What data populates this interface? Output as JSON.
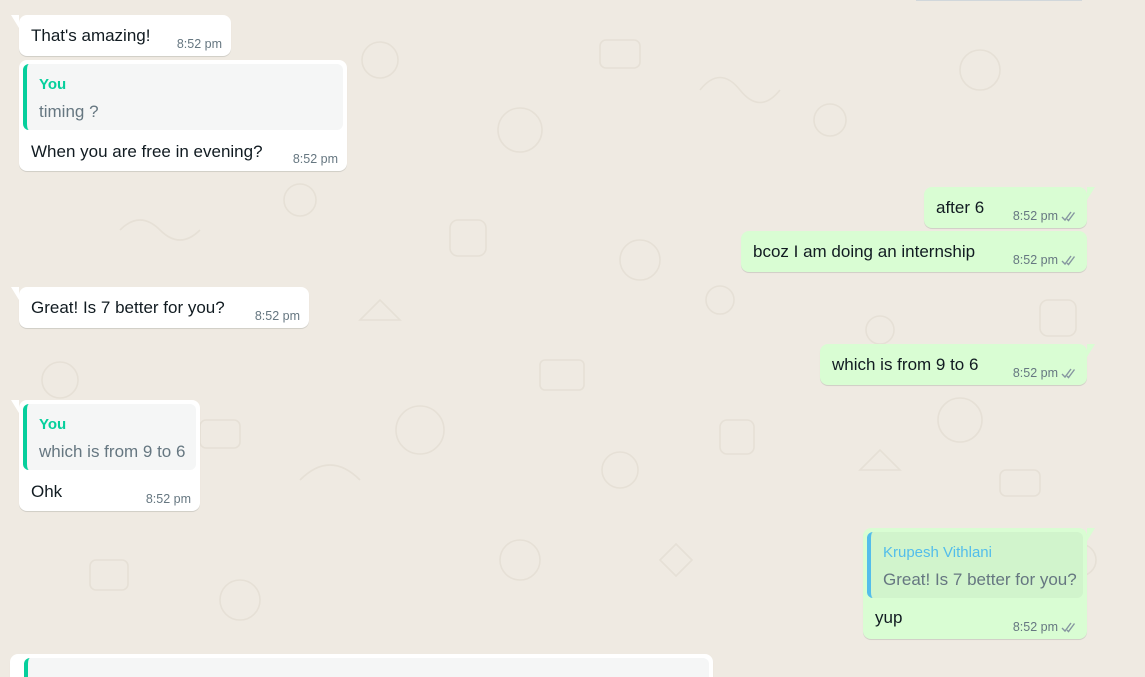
{
  "messages": [
    {
      "id": "m1",
      "dir": "in",
      "text": "That's amazing!",
      "time": "8:52 pm"
    },
    {
      "id": "m2",
      "dir": "in",
      "quote": {
        "author": "You",
        "text": "timing ?"
      },
      "text": "When you are free in evening?",
      "time": "8:52 pm"
    },
    {
      "id": "m3",
      "dir": "out",
      "text": "after 6",
      "time": "8:52 pm",
      "status": "read"
    },
    {
      "id": "m4",
      "dir": "out",
      "text": "bcoz I am doing an internship",
      "time": "8:52 pm",
      "status": "read"
    },
    {
      "id": "m5",
      "dir": "in",
      "text": "Great! Is 7 better for you?",
      "time": "8:52 pm"
    },
    {
      "id": "m6",
      "dir": "out",
      "text": "which is from 9 to 6",
      "time": "8:52 pm",
      "status": "read"
    },
    {
      "id": "m7",
      "dir": "in",
      "quote": {
        "author": "You",
        "text": "which is from 9 to 6"
      },
      "text": "Ohk",
      "time": "8:52 pm"
    },
    {
      "id": "m8",
      "dir": "out",
      "quote": {
        "author": "Krupesh Vithlani",
        "text": "Great! Is 7 better for you?"
      },
      "text": "yup",
      "time": "8:52 pm",
      "status": "read"
    }
  ],
  "icons": {
    "read_status": "double-check-icon"
  },
  "colors": {
    "incoming": "#ffffff",
    "outgoing": "#d9fdd3",
    "quote_accent_in": "#06cf9c",
    "quote_accent_out": "#53bdeb",
    "background": "#efeae2"
  }
}
